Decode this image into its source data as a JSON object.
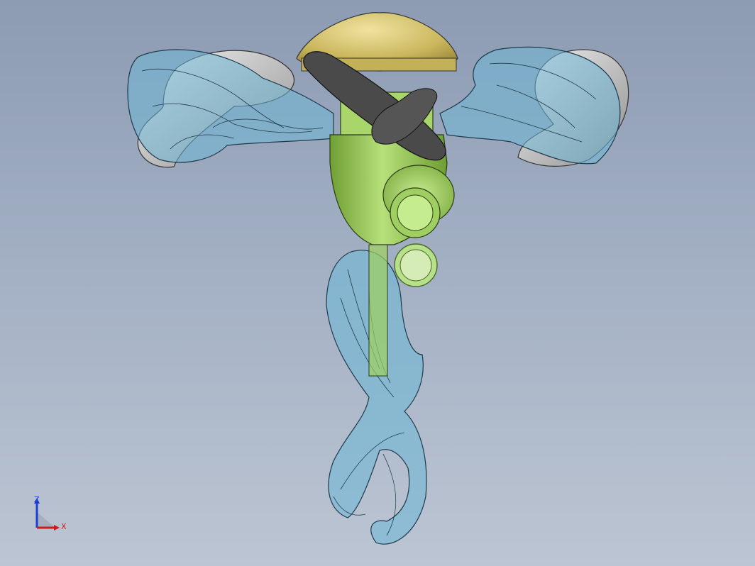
{
  "viewport": {
    "background_top": "#8d9bb3",
    "background_bottom": "#bcc5d3"
  },
  "model": {
    "parts": [
      {
        "name": "cap",
        "color": "#c9b65c"
      },
      {
        "name": "body",
        "color": "#9fd160"
      },
      {
        "name": "transparent-blades",
        "color": "#6fb7d6"
      },
      {
        "name": "dark-blade",
        "color": "#4a4a4a"
      },
      {
        "name": "grey-blades",
        "color": "#cfcfcf"
      }
    ]
  },
  "triad": {
    "z_label": "Z",
    "x_label": "X",
    "z_color": "#1a3fd1",
    "x_color": "#d11a1a"
  }
}
